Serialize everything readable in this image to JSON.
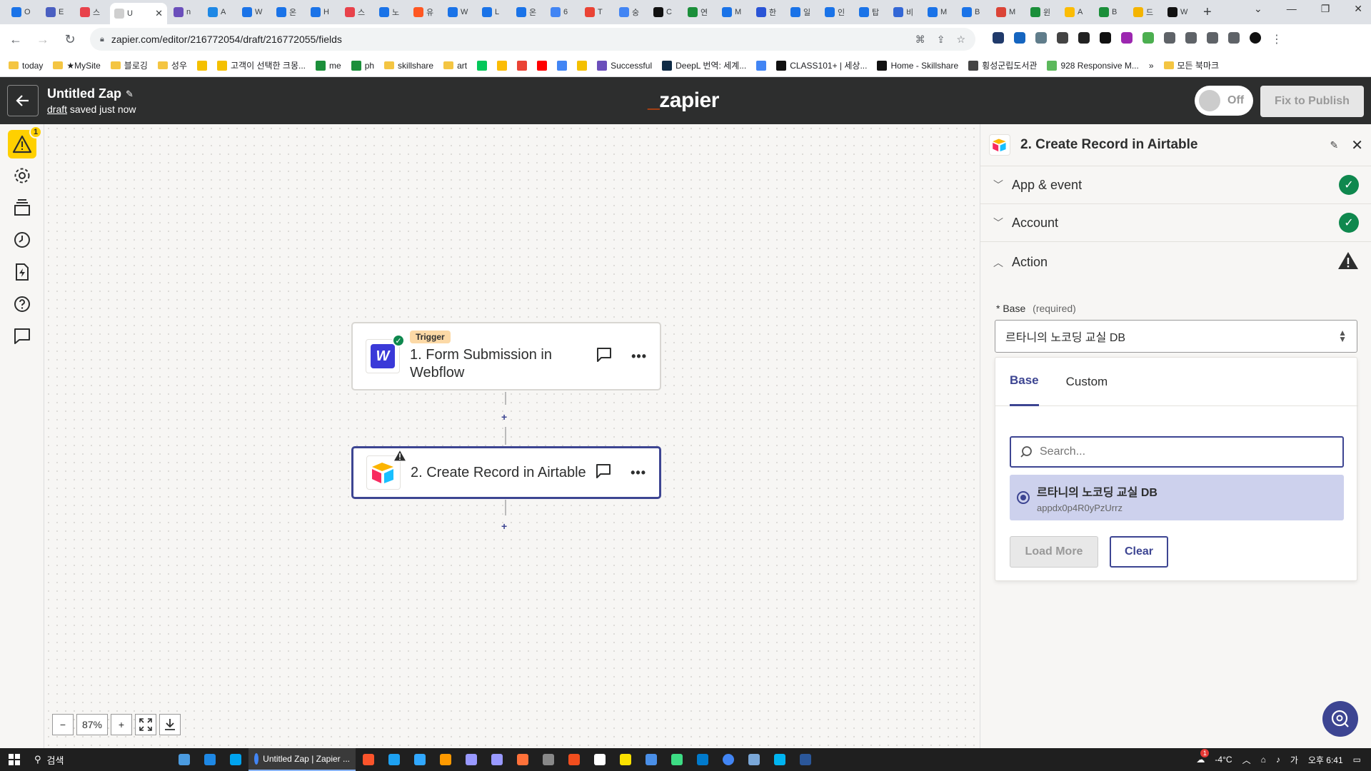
{
  "browser": {
    "active_tab_title": "U",
    "url": "zapier.com/editor/216772054/draft/216772055/fields",
    "tabs": [
      "O",
      "E",
      "스",
      "U",
      "n",
      "A",
      "W",
      "온",
      "H",
      "스",
      "노",
      "유",
      "W",
      "L",
      "온",
      "6",
      "T",
      "숭",
      "C",
      "연",
      "M",
      "한",
      "일",
      "인",
      "탑",
      "비",
      "M",
      "B",
      "M",
      "윈",
      "A",
      "B",
      "드",
      "W"
    ],
    "tab_colors": [
      "#1a73e8",
      "#4a5fc1",
      "#e8424b",
      "#cfcfcf",
      "#6b4fbb",
      "#1e88e5",
      "#1a73e8",
      "#1a73e8",
      "#1a73e8",
      "#e8424b",
      "#1a73e8",
      "#ff5722",
      "#1a73e8",
      "#1a73e8",
      "#1a73e8",
      "#4285f4",
      "#ea4335",
      "#4285f4",
      "#111",
      "#1b8f3a",
      "#1a73e8",
      "#2a54d6",
      "#1a73e8",
      "#1a73e8",
      "#1a73e8",
      "#3367d6",
      "#1a73e8",
      "#1a73e8",
      "#db4437",
      "#1b8f3a",
      "#fbbc05",
      "#1b8f3a",
      "#f4b400",
      "#111"
    ],
    "bookmarks": [
      {
        "label": "today",
        "type": "folder"
      },
      {
        "label": "★MySite",
        "type": "folder"
      },
      {
        "label": "블로깅",
        "type": "folder"
      },
      {
        "label": "성우",
        "type": "folder"
      },
      {
        "label": "",
        "type": "icon",
        "color": "#f4c000"
      },
      {
        "label": "고객이 선택한 크몽...",
        "type": "icon",
        "color": "#f4c000"
      },
      {
        "label": "me",
        "type": "icon",
        "color": "#1b8f3a"
      },
      {
        "label": "ph",
        "type": "icon",
        "color": "#1b8f3a"
      },
      {
        "label": "skillshare",
        "type": "folder"
      },
      {
        "label": "art",
        "type": "folder"
      },
      {
        "label": "",
        "type": "icon",
        "color": "#03c75a"
      },
      {
        "label": "",
        "type": "icon",
        "color": "#fbbc05"
      },
      {
        "label": "",
        "type": "icon",
        "color": "#ea4335"
      },
      {
        "label": "",
        "type": "icon",
        "color": "#ff0000"
      },
      {
        "label": "",
        "type": "icon",
        "color": "#4285f4"
      },
      {
        "label": "",
        "type": "icon",
        "color": "#f4c000"
      },
      {
        "label": "Successful",
        "type": "icon",
        "color": "#6b4fbb"
      },
      {
        "label": "DeepL 번역: 세계...",
        "type": "icon",
        "color": "#0f2b46"
      },
      {
        "label": "",
        "type": "icon",
        "color": "#4285f4"
      },
      {
        "label": "CLASS101+ | 세상...",
        "type": "icon",
        "color": "#111"
      },
      {
        "label": "Home - Skillshare",
        "type": "icon",
        "color": "#111"
      },
      {
        "label": "횡성군립도서관",
        "type": "icon",
        "color": "#444"
      },
      {
        "label": "928 Responsive M...",
        "type": "icon",
        "color": "#5cb85c"
      },
      {
        "label": "»",
        "type": "text"
      },
      {
        "label": "모든 북마크",
        "type": "folder"
      }
    ]
  },
  "header": {
    "zap_title": "Untitled Zap",
    "status_link": "draft",
    "status_suffix": " saved just now",
    "logo_text": "zapier",
    "toggle_label": "Off",
    "publish_label": "Fix to Publish"
  },
  "rail": {
    "warning_count": "1"
  },
  "canvas": {
    "steps": [
      {
        "badge": "Trigger",
        "name": "1. Form Submission in Webflow",
        "status": "ok"
      },
      {
        "badge": "",
        "name": "2. Create Record in Airtable",
        "status": "warning"
      }
    ],
    "zoom": {
      "minus": "−",
      "level": "87%",
      "plus": "+"
    }
  },
  "panel": {
    "title": "2. Create Record in Airtable",
    "sections": [
      {
        "name": "App & event",
        "state": "complete"
      },
      {
        "name": "Account",
        "state": "complete"
      },
      {
        "name": "Action",
        "state": "warning"
      }
    ],
    "base_field": {
      "asterisk": "*",
      "label": "Base",
      "required": "(required)",
      "value": "르타니의 노코딩 교실 DB"
    },
    "dropdown": {
      "tabs": [
        "Base",
        "Custom"
      ],
      "search_placeholder": "Search...",
      "options": [
        {
          "name": "르타니의 노코딩 교실 DB",
          "id": "appdx0p4R0yPzUrrz",
          "selected": true
        }
      ],
      "load_more_label": "Load More",
      "clear_label": "Clear"
    }
  },
  "taskbar": {
    "search_label": "검색",
    "active_app_title": "Untitled Zap | Zapier ...",
    "temperature": "-4°C",
    "ime": "가",
    "time": "오후 6:41",
    "notification_count": "1"
  },
  "colors": {
    "zapier_orange": "#ff4f00",
    "primary_blue": "#3d4592",
    "success_green": "#0f884e",
    "warning_yellow": "#ffd000",
    "header_bg": "#2d2e2e"
  }
}
